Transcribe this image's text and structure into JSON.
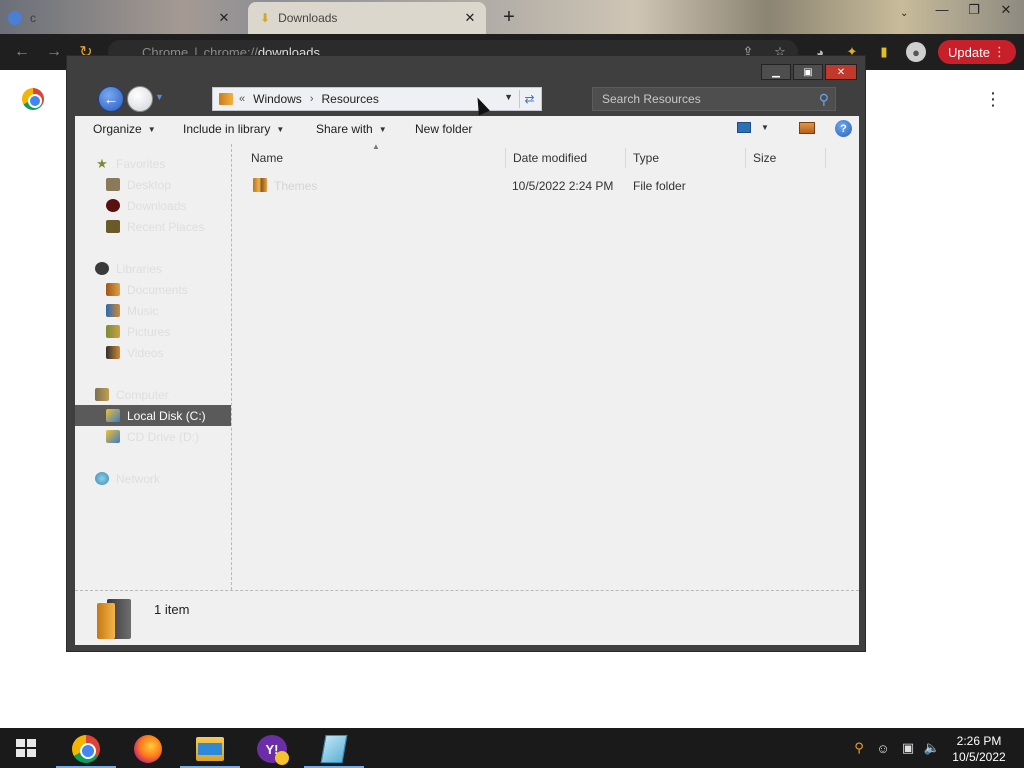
{
  "browser": {
    "tabs": [
      {
        "title": "c",
        "active": false
      },
      {
        "title": "Downloads",
        "active": true
      }
    ],
    "omnibox": {
      "site": "Chrome",
      "url_scheme": "chrome://",
      "url_path": "downloads"
    },
    "update_label": "Update"
  },
  "explorer": {
    "breadcrumb": {
      "overflow": "«",
      "items": [
        "Windows",
        "Resources"
      ]
    },
    "search_placeholder": "Search Resources",
    "commands": {
      "organize": "Organize",
      "include_in_library": "Include in library",
      "share_with": "Share with",
      "new_folder": "New folder"
    },
    "nav": {
      "favorites": {
        "label": "Favorites",
        "items": [
          "Desktop",
          "Downloads",
          "Recent Places"
        ]
      },
      "libraries": {
        "label": "Libraries",
        "items": [
          "Documents",
          "Music",
          "Pictures",
          "Videos"
        ]
      },
      "computer": {
        "label": "Computer",
        "items": [
          "Local Disk (C:)",
          "CD Drive (D:)"
        ]
      },
      "network": {
        "label": "Network"
      }
    },
    "columns": [
      "Name",
      "Date modified",
      "Type",
      "Size"
    ],
    "files": [
      {
        "name": "Themes",
        "date_modified": "10/5/2022 2:24 PM",
        "type": "File folder",
        "size": ""
      }
    ],
    "status": {
      "item_count": "1 item"
    }
  },
  "taskbar": {
    "apps": [
      "chrome-icon",
      "firefox-icon",
      "file-explorer-icon",
      "yahoo-messenger-icon",
      "notepad-icon"
    ],
    "clock": {
      "time": "2:26 PM",
      "date": "10/5/2022"
    }
  },
  "colors": {
    "selected_nav_bg": "#5a5a5a",
    "update_button": "#c8202a",
    "close_button": "#c0392b",
    "taskbar_bg": "#1a1a1a"
  }
}
